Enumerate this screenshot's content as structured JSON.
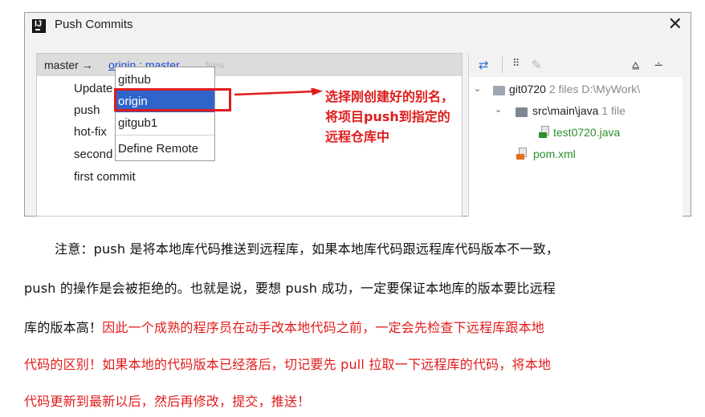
{
  "dialog": {
    "title": "Push Commits",
    "close_symbol": "✕",
    "branch": {
      "local": "master →",
      "remote": "origin : master",
      "badge": "New"
    },
    "commits": [
      "Update",
      "push",
      "hot-fix",
      "second",
      "first commit"
    ],
    "remote_dropdown": {
      "items": [
        "github",
        "origin",
        "gitgub1",
        "Define Remote"
      ],
      "selected": "origin"
    },
    "annotation": [
      "选择刚创建好的别名，",
      "将项目push到指定的",
      "远程仓库中"
    ],
    "toolbar_icons": [
      "pin-icon",
      "group-icon",
      "edit-icon",
      "expand-all-icon",
      "collapse-all-icon"
    ],
    "tree": {
      "root": {
        "name": "git0720",
        "meta": "2 files  D:\\MyWork\\"
      },
      "folder": {
        "name": "src\\main\\java",
        "meta": "1 file"
      },
      "file1": "test0720.java",
      "file2": "pom.xml"
    },
    "colors": {
      "selection": "#2f65ca",
      "annotation": "#e01b1b",
      "link": "#1b4ccc",
      "added_file": "#2c8f2c"
    }
  },
  "paragraph": {
    "line1": "注意：push 是将本地库代码推送到远程库，如果本地库代码跟远程库代码版本不一致，",
    "line2": "push 的操作是会被拒绝的。也就是说，要想 push 成功，一定要保证本地库的版本要比远程",
    "line3_black": "库的版本高！",
    "line3_red": "因此一个成熟的程序员在动手改本地代码之前，一定会先检查下远程库跟本地",
    "line4": "代码的区别！如果本地的代码版本已经落后，切记要先 pull 拉取一下远程库的代码，将本地",
    "line5": "代码更新到最新以后，然后再修改，提交，推送！"
  }
}
